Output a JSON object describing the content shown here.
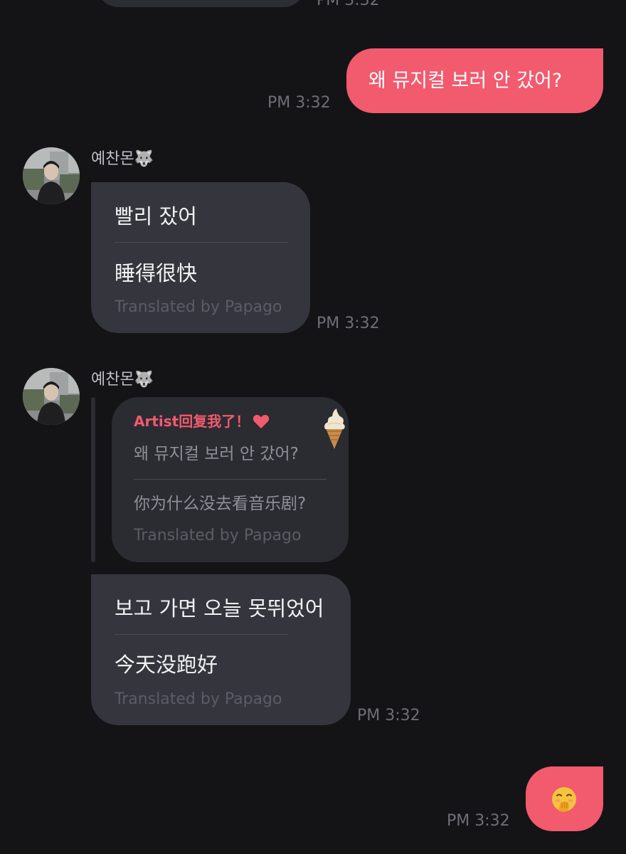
{
  "messages": {
    "outgoing_1": {
      "text": "왜 뮤지컬 보러 안 갔어?",
      "time": "PM 3:32"
    },
    "incoming_1": {
      "sender": "예찬몬🐺",
      "text": "빨리 잤어",
      "translation": "睡得很快",
      "translated_by": "Translated by Papago",
      "time": "PM 3:32"
    },
    "incoming_2": {
      "sender": "예찬몬🐺",
      "reply_quote": {
        "label": "Artist回复我了！",
        "heart_icon": "heart-icon",
        "sticker_icon": "ice-cream-icon",
        "text": "왜 뮤지컬 보러 안 갔어?",
        "translation": "你为什么没去看音乐剧?",
        "translated_by": "Translated by Papago"
      }
    },
    "incoming_3": {
      "text": "보고 가면 오늘 못뛰었어",
      "translation": "今天没跑好",
      "translated_by": "Translated by Papago",
      "time": "PM 3:32"
    },
    "outgoing_2": {
      "emoji": "🤭",
      "time": "PM 3:32"
    }
  },
  "colors": {
    "background": "#141417",
    "accent_pink": "#f25a6e",
    "incoming_bubble": "#35353e"
  }
}
